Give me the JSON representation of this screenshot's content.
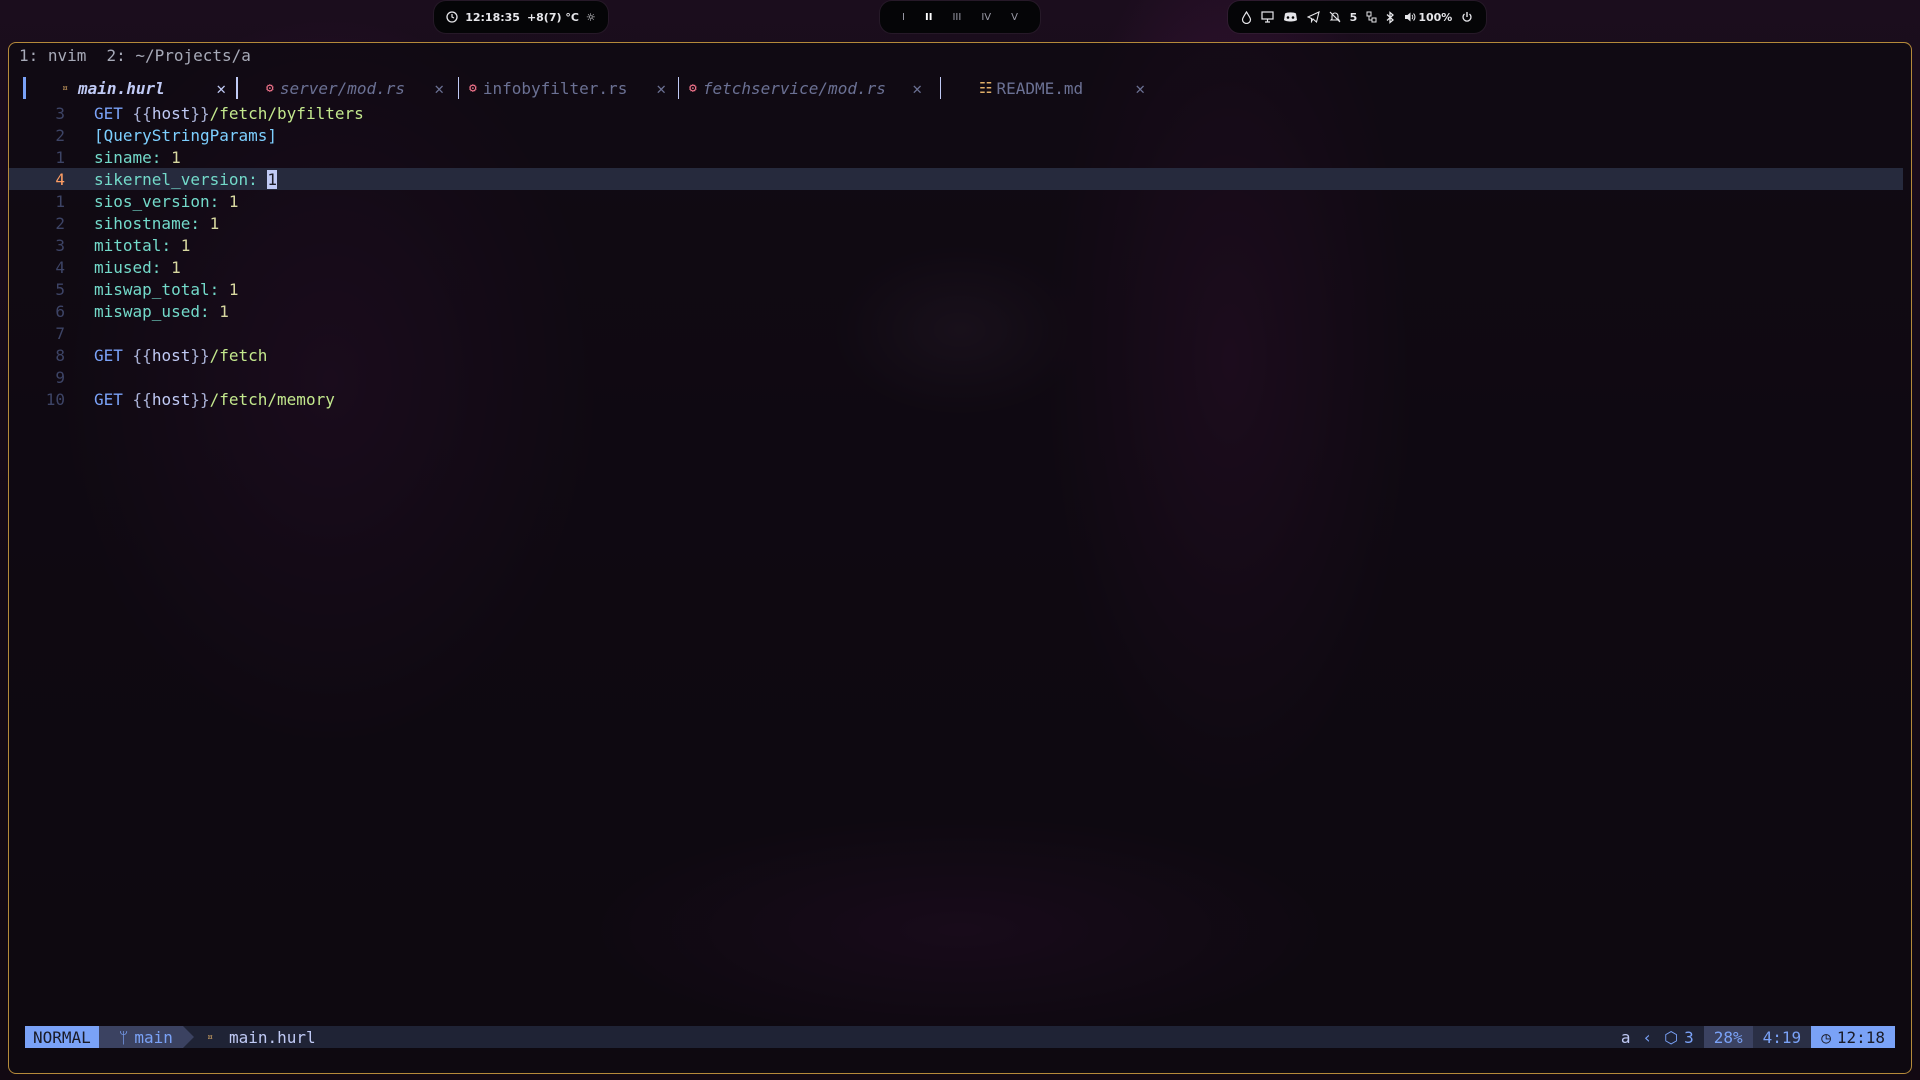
{
  "topbar": {
    "clock_time": "12:18:35",
    "weather": "+8(7) °C",
    "workspaces": [
      {
        "label": "I",
        "active": false
      },
      {
        "label": "II",
        "active": true
      },
      {
        "label": "III",
        "active": false
      },
      {
        "label": "IV",
        "active": false
      },
      {
        "label": "V",
        "active": false
      }
    ],
    "notifications_count": "5",
    "volume": "100%"
  },
  "tmux": {
    "windows": [
      "1: nvim",
      "2: ~/Projects/a"
    ]
  },
  "buffers": [
    {
      "name": "main.hurl",
      "icon": "hurl-icon",
      "active": true
    },
    {
      "name": "server/mod.rs",
      "icon": "rust-icon",
      "active": false
    },
    {
      "name": "infobyfilter.rs",
      "icon": "rust-icon",
      "active": false
    },
    {
      "name": "fetchservice/mod.rs",
      "icon": "rust-icon",
      "active": false
    },
    {
      "name": "README.md",
      "icon": "markdown-icon",
      "active": false
    }
  ],
  "editor": {
    "lines": [
      {
        "nr": "3",
        "method": "GET",
        "host_open": "{{",
        "host": "host",
        "host_close": "}}",
        "path": "/fetch/byfilters"
      },
      {
        "nr": "2",
        "section": "[QueryStringParams]"
      },
      {
        "nr": "1",
        "key": "siname",
        "value": "1"
      },
      {
        "nr": "4",
        "key": "sikernel_version",
        "value": "1",
        "current": true
      },
      {
        "nr": "1",
        "key": "sios_version",
        "value": "1"
      },
      {
        "nr": "2",
        "key": "sihostname",
        "value": "1"
      },
      {
        "nr": "3",
        "key": "mitotal",
        "value": "1"
      },
      {
        "nr": "4",
        "key": "miused",
        "value": "1"
      },
      {
        "nr": "5",
        "key": "miswap_total",
        "value": "1"
      },
      {
        "nr": "6",
        "key": "miswap_used",
        "value": "1"
      },
      {
        "nr": "7"
      },
      {
        "nr": "8",
        "method": "GET",
        "host_open": "{{",
        "host": "host",
        "host_close": "}}",
        "path": "/fetch"
      },
      {
        "nr": "9"
      },
      {
        "nr": "10",
        "method": "GET",
        "host_open": "{{",
        "host": "host",
        "host_close": "}}",
        "path": "/fetch/memory"
      }
    ]
  },
  "statusline": {
    "mode": "NORMAL",
    "branch": "main",
    "file": "main.hurl",
    "register": "a",
    "lsp_count": "3",
    "progress": "28%",
    "position": "4:19",
    "time": "12:18"
  }
}
